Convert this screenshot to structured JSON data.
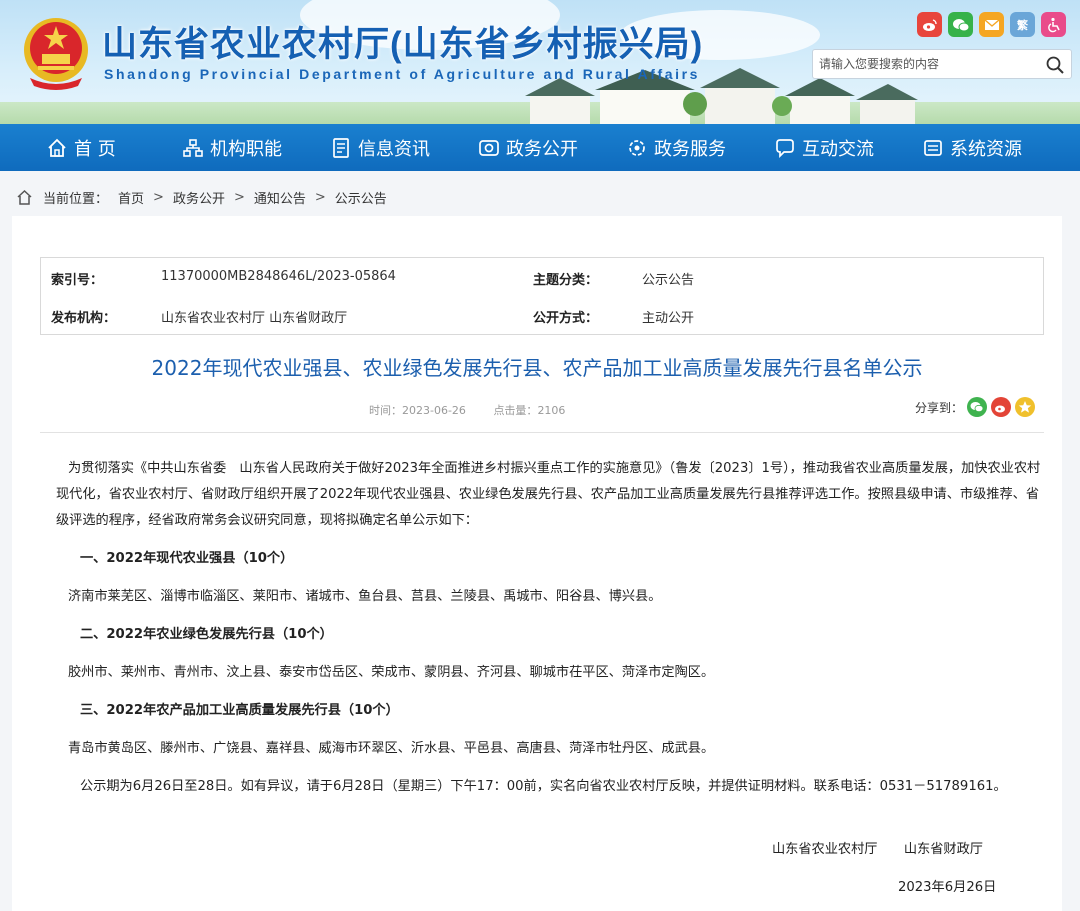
{
  "header": {
    "title": "山东省农业农村厅(山东省乡村振兴局)",
    "subtitle": "Shandong Provincial Department of Agriculture and Rural Affairs",
    "search_placeholder": "请输入您要搜索的内容",
    "social": [
      {
        "icon": "weibo-icon",
        "color": "#e8453c",
        "text": "微"
      },
      {
        "icon": "wechat-icon",
        "color": "#36b24a",
        "text": "信"
      },
      {
        "icon": "mail-icon",
        "color": "#f5a623",
        "text": "✉"
      },
      {
        "icon": "traditional-chinese-icon",
        "color": "#6aa6d8",
        "text": "繁"
      },
      {
        "icon": "accessibility-icon",
        "color": "#e94b8a",
        "text": "♿"
      }
    ]
  },
  "nav": [
    {
      "label": "首 页",
      "icon": "home-icon"
    },
    {
      "label": "机构职能",
      "icon": "org-icon"
    },
    {
      "label": "信息资讯",
      "icon": "news-icon"
    },
    {
      "label": "政务公开",
      "icon": "eye-icon"
    },
    {
      "label": "政务服务",
      "icon": "service-icon"
    },
    {
      "label": "互动交流",
      "icon": "chat-icon"
    },
    {
      "label": "系统资源",
      "icon": "resource-icon"
    }
  ],
  "breadcrumb": {
    "prefix": "当前位置：",
    "items": [
      "首页",
      "政务公开",
      "通知公告",
      "公示公告"
    ]
  },
  "meta": {
    "index_label": "索引号：",
    "index_value": "11370000MB2848646L/2023-05864",
    "topic_label": "主题分类：",
    "topic_value": "公示公告",
    "publisher_label": "发布机构：",
    "publisher_value": "山东省农业农村厅 山东省财政厅",
    "open_label": "公开方式：",
    "open_value": "主动公开"
  },
  "article": {
    "title": "2022年现代农业强县、农业绿色发展先行县、农产品加工业高质量发展先行县名单公示",
    "time_label": "时间：",
    "time": "2023-06-26",
    "clicks_label": "点击量：",
    "clicks": "2106",
    "share_label": "分享到：",
    "intro": "为贯彻落实《中共山东省委　山东省人民政府关于做好2023年全面推进乡村振兴重点工作的实施意见》（鲁发〔2023〕1号），推动我省农业高质量发展，加快农业农村现代化，省农业农村厅、省财政厅组织开展了2022年现代农业强县、农业绿色发展先行县、农产品加工业高质量发展先行县推荐评选工作。按照县级申请、市级推荐、省级评选的程序，经省政府常务会议研究同意，现将拟确定名单公示如下：",
    "section1_title": "一、2022年现代农业强县（10个）",
    "section1_list": "济南市莱芜区、淄博市临淄区、莱阳市、诸城市、鱼台县、莒县、兰陵县、禹城市、阳谷县、博兴县。",
    "section2_title": "二、2022年农业绿色发展先行县（10个）",
    "section2_list": "胶州市、莱州市、青州市、汶上县、泰安市岱岳区、荣成市、蒙阴县、齐河县、聊城市茌平区、菏泽市定陶区。",
    "section3_title": "三、2022年农产品加工业高质量发展先行县（10个）",
    "section3_list": "青岛市黄岛区、滕州市、广饶县、嘉祥县、威海市环翠区、沂水县、平邑县、高唐县、菏泽市牡丹区、成武县。",
    "notice": "公示期为6月26日至28日。如有异议，请于6月28日（星期三）下午17：00前，实名向省农业农村厅反映，并提供证明材料。联系电话：0531－51789161。",
    "sign_org": "山东省农业农村厅　　山东省财政厅",
    "sign_date": "2023年6月26日"
  }
}
